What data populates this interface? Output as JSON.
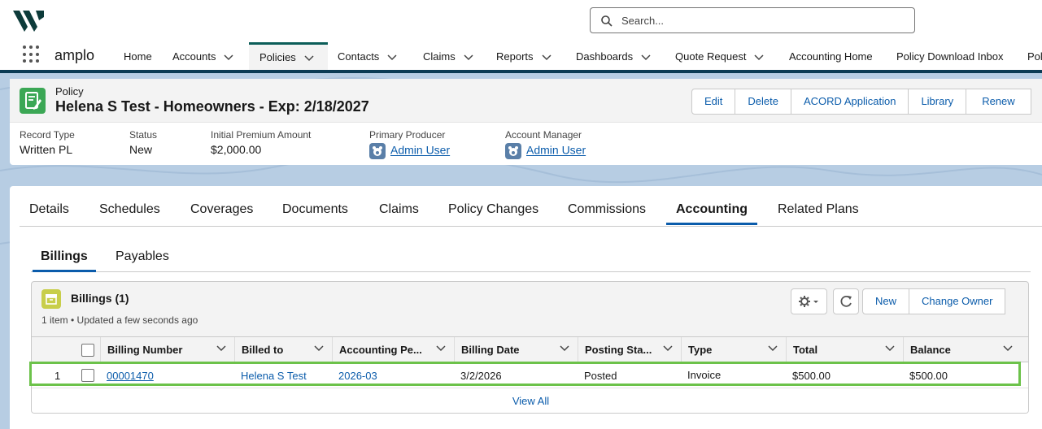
{
  "header": {
    "search_placeholder": "Search..."
  },
  "nav": {
    "app_name": "amplo",
    "items": [
      {
        "label": "Home",
        "has_menu": false
      },
      {
        "label": "Accounts",
        "has_menu": true
      },
      {
        "label": "Policies",
        "has_menu": true,
        "active": true
      },
      {
        "label": "Contacts",
        "has_menu": true
      },
      {
        "label": "Claims",
        "has_menu": true
      },
      {
        "label": "Reports",
        "has_menu": true
      },
      {
        "label": "Dashboards",
        "has_menu": true
      },
      {
        "label": "Quote Request",
        "has_menu": true
      },
      {
        "label": "Accounting Home",
        "has_menu": false
      },
      {
        "label": "Policy Download Inbox",
        "has_menu": false
      },
      {
        "label": "Pol",
        "has_menu": false
      }
    ]
  },
  "record": {
    "object_label": "Policy",
    "title": "Helena S Test - Homeowners - Exp: 2/18/2027",
    "actions": [
      "Edit",
      "Delete",
      "ACORD Application",
      "Library",
      "Renew"
    ],
    "fields": [
      {
        "label": "Record Type",
        "value": "Written PL"
      },
      {
        "label": "Status",
        "value": "New"
      },
      {
        "label": "Initial Premium Amount",
        "value": "$2,000.00"
      },
      {
        "label": "Primary Producer",
        "value": "Admin User"
      },
      {
        "label": "Account Manager",
        "value": "Admin User"
      }
    ]
  },
  "tabs": [
    "Details",
    "Schedules",
    "Coverages",
    "Documents",
    "Claims",
    "Policy Changes",
    "Commissions",
    "Accounting",
    "Related Plans"
  ],
  "active_tab": "Accounting",
  "subtabs": [
    "Billings",
    "Payables"
  ],
  "active_subtab": "Billings",
  "related_list": {
    "title": "Billings (1)",
    "subtitle": "1 item • Updated a few seconds ago",
    "actions": [
      "New",
      "Change Owner"
    ],
    "columns": [
      "Billing Number",
      "Billed to",
      "Accounting Pe...",
      "Billing Date",
      "Posting Sta...",
      "Type",
      "Total",
      "Balance"
    ],
    "rows": [
      {
        "index": "1",
        "billing_number": "00001470",
        "billed_to": "Helena S Test",
        "accounting_period": "2026-03",
        "billing_date": "3/2/2026",
        "posting_status": "Posted",
        "type": "Invoice",
        "total": "$500.00",
        "balance": "$500.00"
      }
    ],
    "view_all": "View All"
  },
  "colors": {
    "accent": "#0b5cab",
    "nav_active_border": "#0b5d58",
    "highlight": "#6cc24a",
    "record_icon": "#3ba755",
    "billing_icon": "#c8ce4a"
  }
}
